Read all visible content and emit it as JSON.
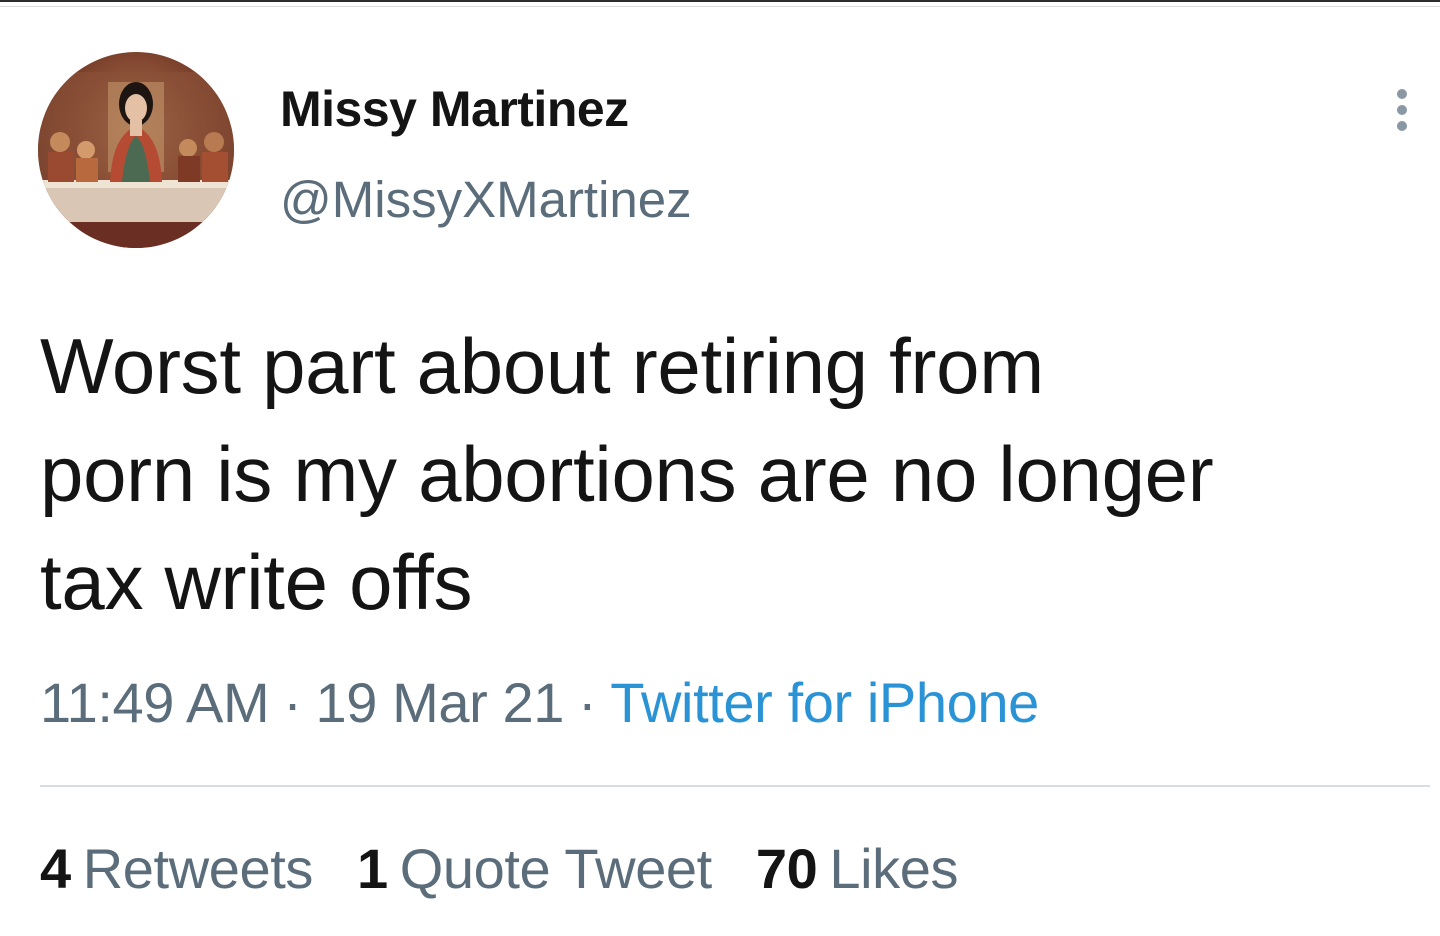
{
  "tweet": {
    "author": {
      "display_name": "Missy Martinez",
      "handle": "@MissyXMartinez"
    },
    "text_lines": [
      "Worst part about retiring from",
      "porn is my abortions are no longer",
      "tax write offs"
    ],
    "time": "11:49 AM",
    "separator": "·",
    "date": "19 Mar 21",
    "source": "Twitter for iPhone",
    "stats": {
      "retweets_count": "4",
      "retweets_label": "Retweets",
      "quotes_count": "1",
      "quotes_label": "Quote Tweet",
      "likes_count": "70",
      "likes_label": "Likes"
    }
  },
  "icons": {
    "more": "more-vertical-icon"
  },
  "colors": {
    "text_primary": "#141414",
    "text_secondary": "#5b6d7b",
    "link": "#2a93d5",
    "divider": "#d7dde2"
  }
}
